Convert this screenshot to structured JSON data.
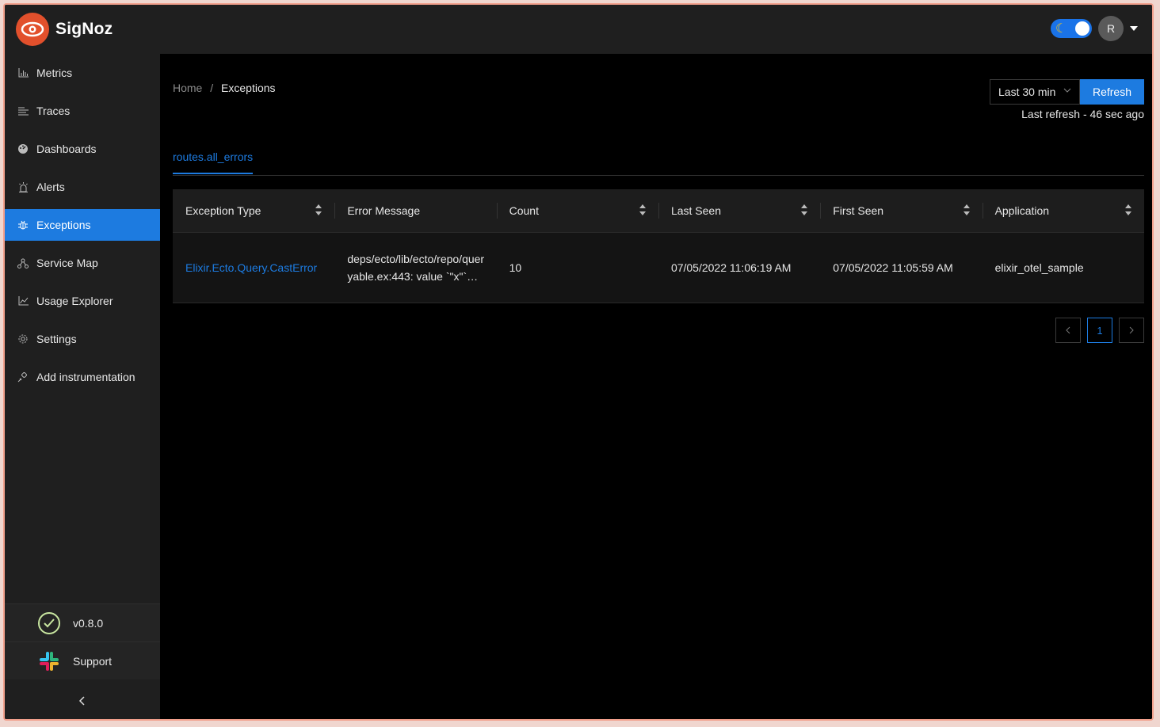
{
  "app": {
    "name": "SigNoz"
  },
  "header": {
    "avatar_initial": "R"
  },
  "sidebar": {
    "items": [
      {
        "label": "Metrics",
        "icon": "bar-chart-icon"
      },
      {
        "label": "Traces",
        "icon": "align-left-icon"
      },
      {
        "label": "Dashboards",
        "icon": "dashboard-icon"
      },
      {
        "label": "Alerts",
        "icon": "alarm-icon"
      },
      {
        "label": "Exceptions",
        "icon": "bug-icon",
        "active": true
      },
      {
        "label": "Service Map",
        "icon": "deployment-icon"
      },
      {
        "label": "Usage Explorer",
        "icon": "line-chart-icon"
      },
      {
        "label": "Settings",
        "icon": "gear-icon"
      },
      {
        "label": "Add instrumentation",
        "icon": "api-icon"
      }
    ],
    "version": "v0.8.0",
    "support": "Support"
  },
  "breadcrumb": {
    "home": "Home",
    "separator": "/",
    "current": "Exceptions"
  },
  "time": {
    "range": "Last 30 min",
    "refresh_label": "Refresh",
    "last_refresh": "Last refresh - 46 sec ago"
  },
  "tabs": {
    "active": "routes.all_errors"
  },
  "table": {
    "columns": [
      "Exception Type",
      "Error Message",
      "Count",
      "Last Seen",
      "First Seen",
      "Application"
    ],
    "rows": [
      {
        "exception_type": "Elixir.Ecto.Query.CastError",
        "error_message": "deps/ecto/lib/ecto/repo/queryable.ex:443: value `\"x\"`…",
        "count": "10",
        "last_seen": "07/05/2022 11:06:19 AM",
        "first_seen": "07/05/2022 11:05:59 AM",
        "application": "elixir_otel_sample"
      }
    ]
  },
  "pagination": {
    "current_page": "1"
  },
  "colors": {
    "accent": "#1d7be0",
    "logo": "#e2502c",
    "sidebar": "#1f1f1f"
  }
}
